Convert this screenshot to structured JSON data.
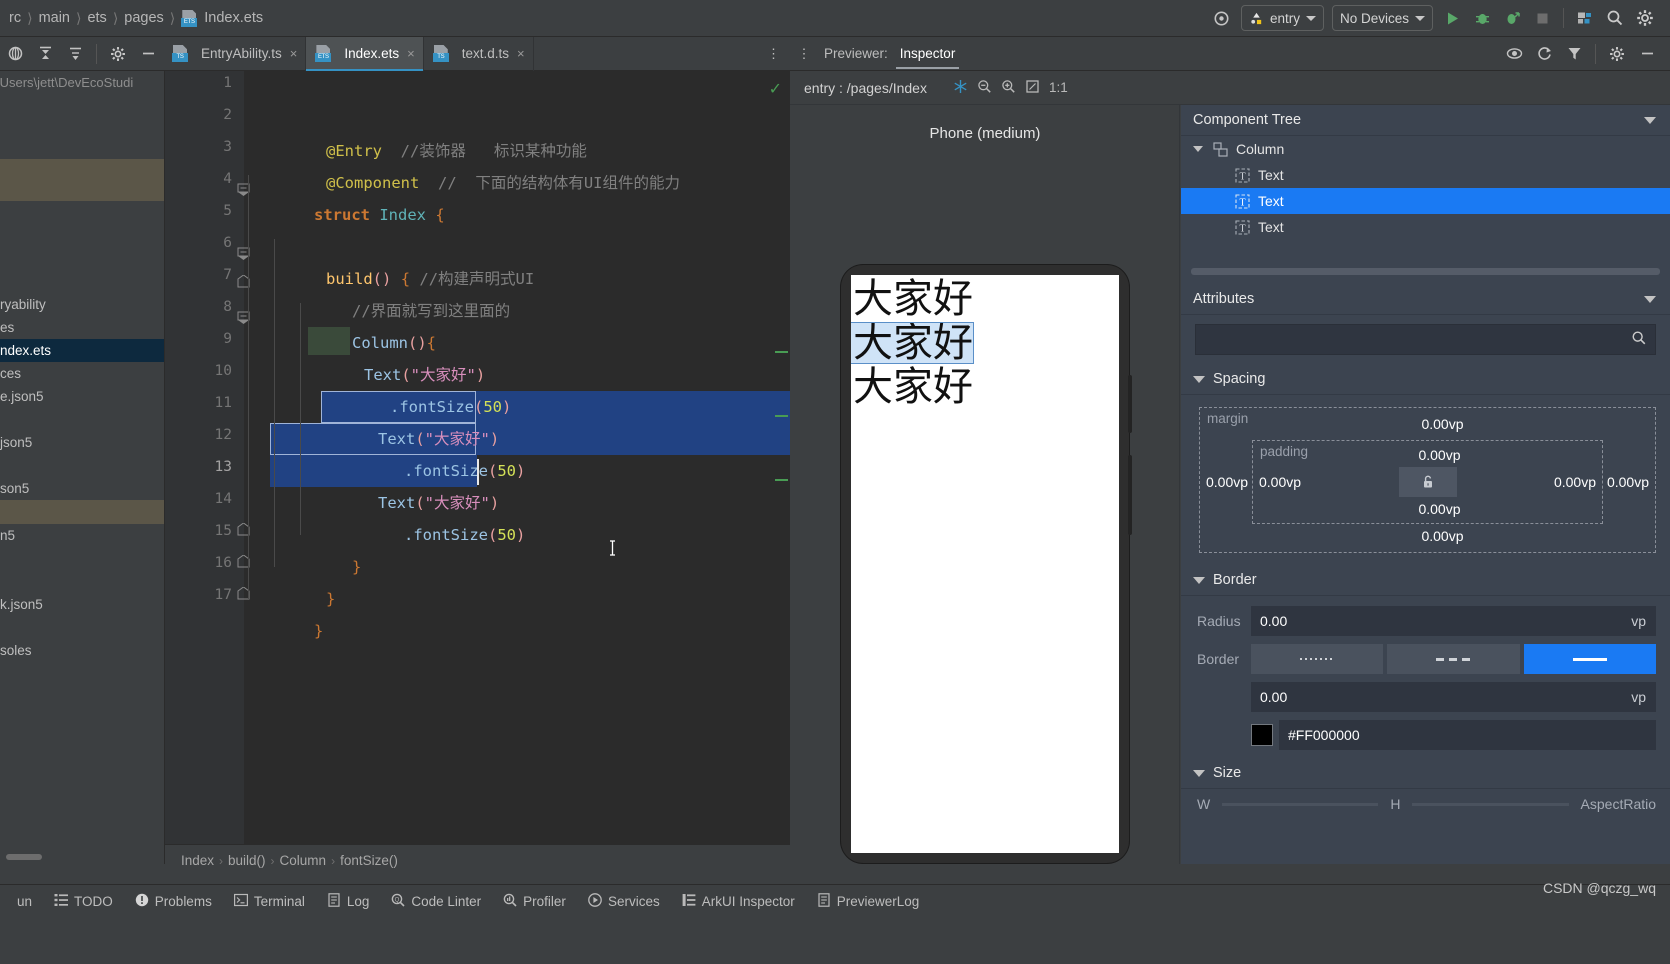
{
  "topbar": {
    "breadcrumb": [
      "rc",
      "main",
      "ets",
      "pages",
      "Index.ets"
    ],
    "run_config": "entry",
    "device": "No Devices",
    "icons": [
      "target-icon",
      "run-icon",
      "debug-icon",
      "profile-run-icon",
      "stop-icon",
      "device-manager-icon",
      "search-icon",
      "settings-icon"
    ]
  },
  "tabstrip": {
    "tools": [
      "expand-all-icon",
      "collapse-all-icon",
      "sort-icon",
      "settings-icon",
      "minimize-icon"
    ],
    "tabs": [
      {
        "label": "EntryAbility.ts",
        "close": "×",
        "badge": "TS"
      },
      {
        "label": "Index.ets",
        "close": "×",
        "badge": "ETS"
      },
      {
        "label": "text.d.ts",
        "close": "×",
        "badge": "TS"
      }
    ],
    "overflow": "⋮"
  },
  "project": {
    "path": "\\Users\\jett\\DevEcoStudi",
    "items": [
      "ryability",
      "es",
      "ndex.ets",
      "ces",
      "e.json5",
      "json5",
      "son5",
      "n5",
      "k.json5",
      "soles"
    ]
  },
  "editor": {
    "lines": [
      {
        "n": "1",
        "text": ""
      },
      {
        "n": "2",
        "text": "@Entry  //装饰器   标识某种功能"
      },
      {
        "n": "3",
        "text": "@Component  // 下面的结构体有UI组件的能力"
      },
      {
        "n": "4",
        "text": "struct Index {"
      },
      {
        "n": "5",
        "text": ""
      },
      {
        "n": "6",
        "text": "  build() { //构建声明式UI"
      },
      {
        "n": "7",
        "text": "    //界面就写到这里面的"
      },
      {
        "n": "8",
        "text": "    Column(){"
      },
      {
        "n": "9",
        "text": "      Text(\"大家好\")"
      },
      {
        "n": "10",
        "text": "        .fontSize(50)"
      },
      {
        "n": "11",
        "text": "      Text(\"大家好\")"
      },
      {
        "n": "12",
        "text": "        .fontSize(50)"
      },
      {
        "n": "13",
        "text": "      Text(\"大家好\")"
      },
      {
        "n": "14",
        "text": "        .fontSize(50)"
      },
      {
        "n": "15",
        "text": "    }"
      },
      {
        "n": "16",
        "text": "  }"
      },
      {
        "n": "17",
        "text": "}"
      }
    ],
    "tok": {
      "entry": "@Entry",
      "c_entry": "//装饰器",
      "c_entry2": "标识某种功能",
      "component": "@Component",
      "c_component": "//  下面的结构体有UI组件的能力",
      "struct": "struct",
      "index": "Index",
      "brace_open": "{",
      "brace_close": "}",
      "build": "build",
      "parens": "()",
      "c_build": "//构建声明式UI",
      "c_ui": "//界面就写到这里面的",
      "column": "Column",
      "text": "Text",
      "str": "\"大家好\"",
      "fontsize": ".fontSize",
      "num50": "50"
    },
    "breadcrumb": [
      "Index",
      "build()",
      "Column",
      "fontSize()"
    ],
    "ok_mark": "✓"
  },
  "previewer": {
    "tabs": [
      {
        "label": "Previewer:"
      },
      {
        "label": "Inspector"
      }
    ],
    "right_icons": [
      "eye-icon",
      "refresh-icon",
      "filter-icon",
      "settings-icon",
      "minimize-icon"
    ],
    "route": "entry : /pages/Index",
    "zoom_tools": [
      "snowflake-icon",
      "zoom-out-icon",
      "zoom-in-icon",
      "fit-screen-icon"
    ],
    "zoom_ratio": "1:1",
    "phone_label": "Phone (medium)",
    "screen_texts": [
      "大家好",
      "大家好",
      "大家好"
    ],
    "selected_screen_index": 1
  },
  "inspector": {
    "component_tree_title": "Component Tree",
    "tree": [
      {
        "label": "Column",
        "depth": 0,
        "icon": "column-node-icon",
        "selected": false,
        "expanded": true
      },
      {
        "label": "Text",
        "depth": 1,
        "icon": "text-node-icon",
        "selected": false
      },
      {
        "label": "Text",
        "depth": 1,
        "icon": "text-node-icon",
        "selected": true
      },
      {
        "label": "Text",
        "depth": 1,
        "icon": "text-node-icon",
        "selected": false
      }
    ],
    "attributes_title": "Attributes",
    "search_value": "",
    "search_placeholder": "",
    "spacing": {
      "title": "Spacing",
      "margin_label": "margin",
      "padding_label": "padding",
      "margin_top": "0.00vp",
      "margin_bottom": "0.00vp",
      "margin_left": "0.00vp",
      "margin_right": "0.00vp",
      "padding_top": "0.00vp",
      "padding_bottom": "0.00vp",
      "padding_left": "0.00vp",
      "padding_right": "0.00vp",
      "lock": "lock-icon"
    },
    "border": {
      "title": "Border",
      "radius_label": "Radius",
      "radius_value": "0.00",
      "radius_unit": "vp",
      "border_label": "Border",
      "styles": [
        "dotted",
        "dashed",
        "solid"
      ],
      "active_style": 2,
      "width_value": "0.00",
      "width_unit": "vp",
      "color_value": "#FF000000",
      "color_swatch": "#000000"
    },
    "size": {
      "title": "Size",
      "w_label": "W",
      "h_label": "H",
      "aspect_label": "AspectRatio"
    }
  },
  "bottombar": {
    "items": [
      {
        "label": "un",
        "icon": "run-icon"
      },
      {
        "label": "TODO",
        "icon": "todo-icon"
      },
      {
        "label": "Problems",
        "icon": "problems-icon"
      },
      {
        "label": "Terminal",
        "icon": "terminal-icon"
      },
      {
        "label": "Log",
        "icon": "log-icon"
      },
      {
        "label": "Code Linter",
        "icon": "code-linter-icon"
      },
      {
        "label": "Profiler",
        "icon": "profiler-icon"
      },
      {
        "label": "Services",
        "icon": "services-icon"
      },
      {
        "label": "ArkUI Inspector",
        "icon": "arkui-inspector-icon"
      },
      {
        "label": "PreviewerLog",
        "icon": "previewer-log-icon"
      }
    ]
  },
  "watermark": "CSDN @qczg_wq",
  "colors": {
    "accent_blue": "#1a7af3",
    "selection_blue": "#214283",
    "editor_bg": "#2b2b2b",
    "panel_bg": "#3c3f41",
    "inspector_bg": "#3c4450",
    "green": "#499c54"
  }
}
